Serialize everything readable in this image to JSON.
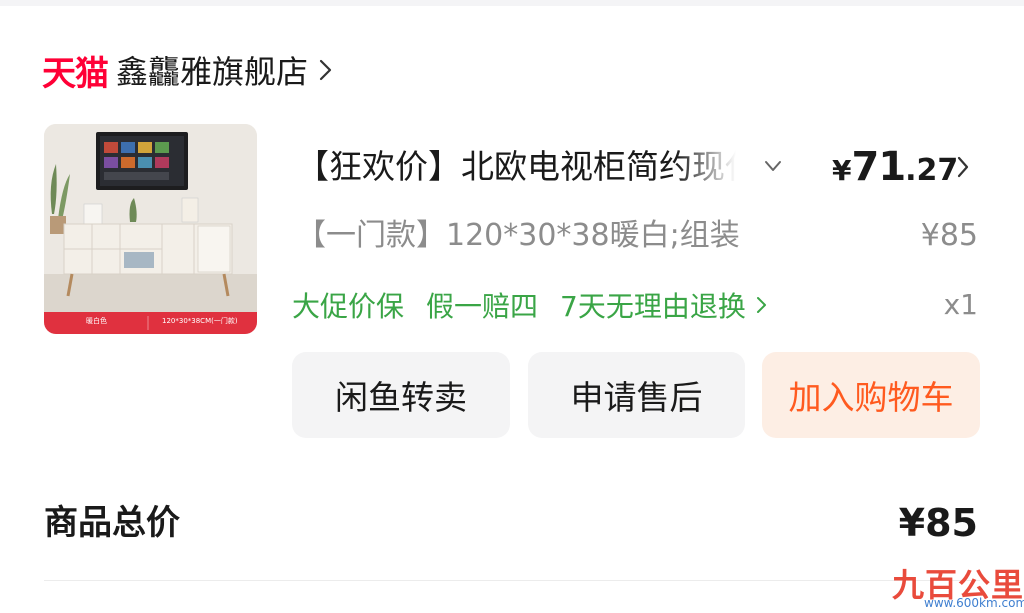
{
  "shop": {
    "platform_logo": "天猫",
    "name": "鑫龘雅旗舰店",
    "chevron_icon": "chevron-right-icon"
  },
  "product": {
    "image_caption_left": "暖白色",
    "image_caption_right": "120*30*38CM(一门款)",
    "title": "【狂欢价】北欧电视柜简约现代",
    "expand_icon": "chevron-down-icon",
    "price": {
      "currency": "¥",
      "integer": "71",
      "decimal": ".27"
    },
    "price_chevron_icon": "chevron-right-icon",
    "spec": "【一门款】120*30*38暖白;组装",
    "original_price": "¥85",
    "services": [
      "大促价保",
      "假一赔四",
      "7天无理由退换"
    ],
    "services_chevron_icon": "chevron-right-icon",
    "quantity": "x1"
  },
  "actions": {
    "resell": "闲鱼转卖",
    "after_sale": "申请售后",
    "add_to_cart": "加入购物车"
  },
  "summary": {
    "total_label": "商品总价",
    "total_value": "¥85"
  },
  "watermark": {
    "text": "九百公里",
    "url": "www.600km.com"
  },
  "colors": {
    "tmall_red": "#ff0036",
    "service_green": "#3aa546",
    "cart_orange": "#ff5a1f",
    "cart_bg": "#fdeee4",
    "button_bg": "#f4f4f5"
  }
}
